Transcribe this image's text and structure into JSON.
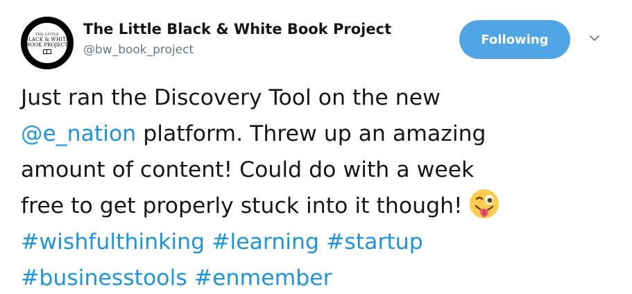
{
  "author": {
    "display_name": "The Little Black & White Book Project",
    "handle": "@bw_book_project",
    "avatar_logo": {
      "line1": "THE LITTLE",
      "line2": "BLACK & WHITE",
      "line3": "BOOK PROJECT"
    }
  },
  "follow_button": {
    "label": "Following",
    "color": "#4fa5e6"
  },
  "menu": {
    "icon": "chevron-down-icon"
  },
  "tweet": {
    "line1": "Just ran the Discovery Tool on the new",
    "mention": "@e_nation",
    "line2_rest": " platform. Threw up an amazing",
    "line3": "amount of content! Could do with a week",
    "line4": "free to get properly stuck into it though!",
    "emoji": "winking-face-with-tongue",
    "hashtags_line1": [
      "#wishfulthinking",
      "#learning",
      "#startup"
    ],
    "hashtags_line2": [
      "#businesstools",
      "#enmember"
    ],
    "link_color": "#1b95e0"
  }
}
